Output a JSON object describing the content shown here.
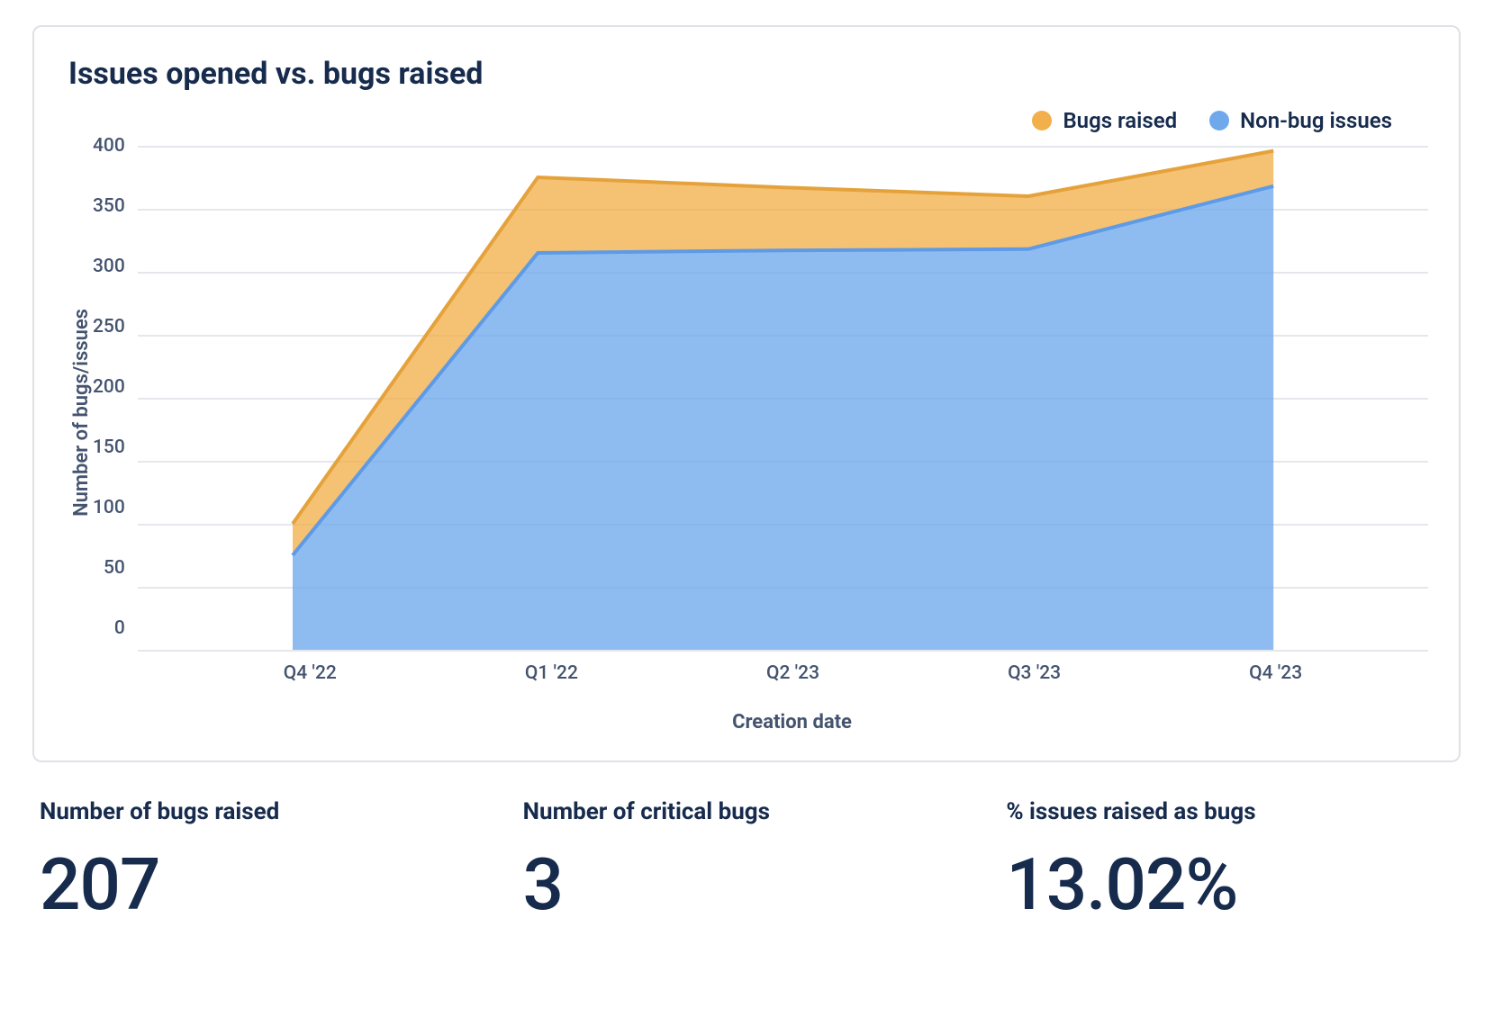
{
  "chart_data": {
    "type": "area",
    "title": "Issues opened vs. bugs raised",
    "xlabel": "Creation date",
    "ylabel": "Number of bugs/issues",
    "categories": [
      "Q4 '22",
      "Q1 '22",
      "Q2 '23",
      "Q3 '23",
      "Q4 '23"
    ],
    "y_ticks": [
      0,
      50,
      100,
      150,
      200,
      250,
      300,
      350,
      400
    ],
    "ylim": [
      0,
      400
    ],
    "stacked": true,
    "series": [
      {
        "name": "Non-bug issues",
        "color": "#6FA9EC",
        "values": [
          75,
          315,
          317,
          318,
          368
        ]
      },
      {
        "name": "Bugs raised",
        "color": "#F2B04C",
        "values": [
          25,
          60,
          50,
          42,
          28
        ]
      }
    ],
    "legend_position": "top-right"
  },
  "legend": {
    "bugs": "Bugs raised",
    "nonbug": "Non-bug issues"
  },
  "kpis": [
    {
      "label": "Number of bugs raised",
      "value": "207"
    },
    {
      "label": "Number of critical bugs",
      "value": "3"
    },
    {
      "label": "% issues raised as bugs",
      "value": "13.02%"
    }
  ]
}
